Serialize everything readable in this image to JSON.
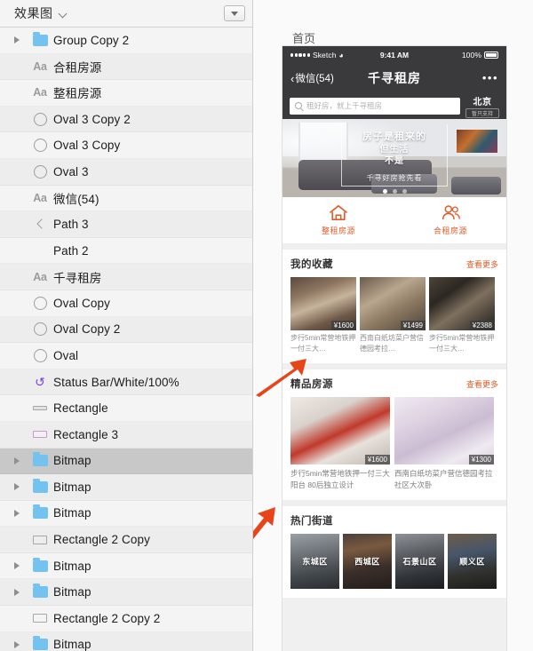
{
  "panel": {
    "title": "效果图",
    "dropdown_icon": "chevron-down-icon",
    "filter_icon": "triangle-down-icon",
    "layers": [
      {
        "name": "Group Copy 2",
        "icon": "folder-icon",
        "disclosure": true,
        "selected": false
      },
      {
        "name": "合租房源",
        "icon": "text-icon",
        "disclosure": false,
        "selected": false
      },
      {
        "name": "整租房源",
        "icon": "text-icon",
        "disclosure": false,
        "selected": false
      },
      {
        "name": "Oval 3 Copy 2",
        "icon": "oval-icon",
        "disclosure": false,
        "selected": false
      },
      {
        "name": "Oval 3 Copy",
        "icon": "oval-icon",
        "disclosure": false,
        "selected": false
      },
      {
        "name": "Oval 3",
        "icon": "oval-icon",
        "disclosure": false,
        "selected": false
      },
      {
        "name": "微信(54)",
        "icon": "text-icon",
        "disclosure": false,
        "selected": false
      },
      {
        "name": "Path 3",
        "icon": "path-icon",
        "disclosure": false,
        "selected": false
      },
      {
        "name": "Path 2",
        "icon": "none",
        "disclosure": false,
        "selected": false
      },
      {
        "name": "千寻租房",
        "icon": "text-icon",
        "disclosure": false,
        "selected": false
      },
      {
        "name": "Oval Copy",
        "icon": "oval-icon",
        "disclosure": false,
        "selected": false
      },
      {
        "name": "Oval Copy 2",
        "icon": "oval-icon",
        "disclosure": false,
        "selected": false
      },
      {
        "name": "Oval",
        "icon": "oval-icon",
        "disclosure": false,
        "selected": false
      },
      {
        "name": "Status Bar/White/100%",
        "icon": "symbol-icon",
        "disclosure": false,
        "selected": false
      },
      {
        "name": "Rectangle",
        "icon": "rect-thin-icon",
        "disclosure": false,
        "selected": false
      },
      {
        "name": "Rectangle 3",
        "icon": "rect-pink-icon",
        "disclosure": false,
        "selected": false
      },
      {
        "name": "Bitmap",
        "icon": "folder-icon",
        "disclosure": true,
        "selected": true
      },
      {
        "name": "Bitmap",
        "icon": "folder-icon",
        "disclosure": true,
        "selected": false
      },
      {
        "name": "Bitmap",
        "icon": "folder-icon",
        "disclosure": true,
        "selected": false
      },
      {
        "name": "Rectangle 2 Copy",
        "icon": "rect-open-icon",
        "disclosure": false,
        "selected": false
      },
      {
        "name": "Bitmap",
        "icon": "folder-icon",
        "disclosure": true,
        "selected": false
      },
      {
        "name": "Bitmap",
        "icon": "folder-icon",
        "disclosure": true,
        "selected": false
      },
      {
        "name": "Rectangle 2 Copy 2",
        "icon": "rect-open-icon",
        "disclosure": false,
        "selected": false
      },
      {
        "name": "Bitmap",
        "icon": "folder-icon",
        "disclosure": true,
        "selected": false
      }
    ]
  },
  "canvas": {
    "artboard_label": "首页",
    "accent_color": "#e05b26",
    "arrow_color": "#e8441a"
  },
  "phone": {
    "status": {
      "carrier": "Sketch",
      "signal_dots": 5,
      "wifi_icon": "wifi-icon",
      "time": "9:41 AM",
      "battery_percent": "100%",
      "battery_icon": "battery-full-icon"
    },
    "nav": {
      "back_icon": "chevron-left-icon",
      "back_label": "微信(54)",
      "title": "千寻租房",
      "more_icon": "more-horizontal-icon",
      "more_label": "•••"
    },
    "search": {
      "icon": "search-icon",
      "placeholder": "租好房，就上千寻租房",
      "value": ""
    },
    "location": {
      "city": "北京",
      "badge": "暂只支持"
    },
    "hero": {
      "line1": "房子是租来的",
      "line2": "但生活",
      "line3": "不是",
      "sub": "千寻好房抢先看",
      "dots": 3,
      "active_dot": 1
    },
    "categories": [
      {
        "label": "整租房源",
        "icon": "house-icon"
      },
      {
        "label": "合租房源",
        "icon": "people-icon"
      }
    ],
    "sections": [
      {
        "title": "我的收藏",
        "more": "查看更多",
        "layout": "three-up",
        "cards": [
          {
            "price": "¥1600",
            "desc": "步行5min常营地铁押一付三大…",
            "selected": true
          },
          {
            "price": "¥1499",
            "desc": "西南白纸坊菜户营信德园考拉…",
            "selected": false
          },
          {
            "price": "¥2388",
            "desc": "步行5min常营地铁押一付三大…",
            "selected": false
          }
        ]
      },
      {
        "title": "精品房源",
        "more": "查看更多",
        "layout": "two-up",
        "cards": [
          {
            "price": "¥1600",
            "desc": "步行5min常营地铁押一付三大阳台 80后独立设计",
            "selected": false
          },
          {
            "price": "¥1300",
            "desc": "西南白纸坊菜户营信德园考拉社区大次卧",
            "selected": false
          }
        ]
      },
      {
        "title": "热门街道",
        "more": "",
        "layout": "tiles",
        "tiles": [
          {
            "label": "东城区"
          },
          {
            "label": "西城区"
          },
          {
            "label": "石景山区"
          },
          {
            "label": "顺义区"
          }
        ]
      }
    ]
  },
  "annotations": {
    "arrows": [
      {
        "name": "arrow-to-favorites-card",
        "color": "#e8441a"
      },
      {
        "name": "arrow-to-selected-layer",
        "color": "#e8441a"
      }
    ]
  }
}
